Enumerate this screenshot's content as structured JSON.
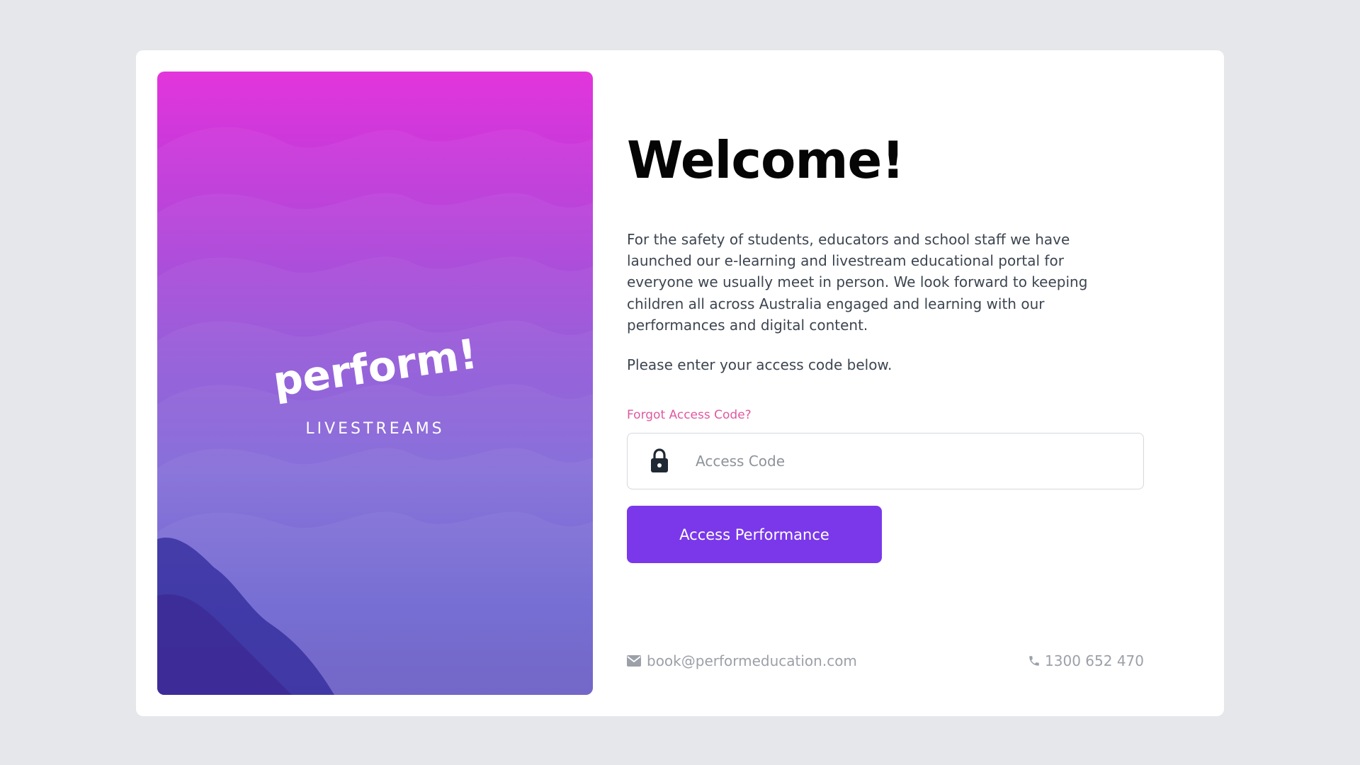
{
  "hero": {
    "logo_text": "perform!",
    "subtitle": "LIVESTREAMS"
  },
  "main": {
    "title": "Welcome!",
    "intro": "For the safety of students, educators and school staff we have launched our e-learning and livestream educational portal for everyone we usually meet in person. We look forward to keeping children all across Australia engaged and learning with our performances and digital content.",
    "prompt": "Please enter your access code below.",
    "forgot_label": "Forgot Access Code?",
    "access_code": {
      "value": "",
      "placeholder": "Access Code",
      "icon": "lock-icon"
    },
    "submit_label": "Access Performance"
  },
  "footer": {
    "email": "book@performeducation.com",
    "email_icon": "mail-icon",
    "phone": "1300 652 470",
    "phone_icon": "phone-icon"
  },
  "colors": {
    "page_bg": "#e5e7eb",
    "accent": "#7a38ea",
    "link": "#e0589e",
    "hero_top": "#e236dc",
    "hero_bottom": "#4434b8"
  }
}
